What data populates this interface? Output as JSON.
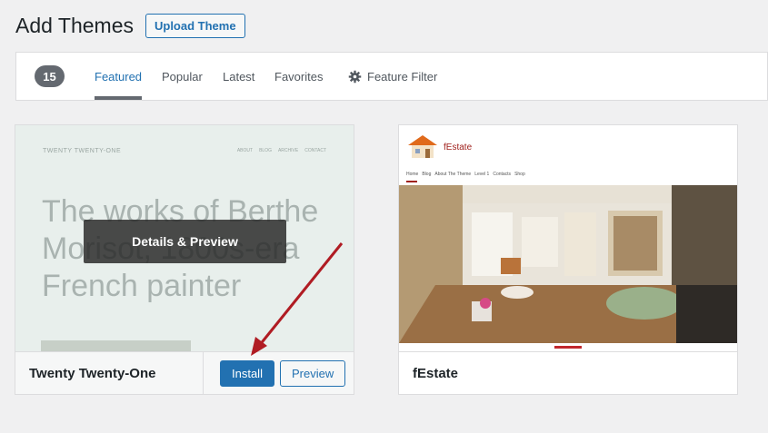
{
  "header": {
    "title": "Add Themes",
    "upload_label": "Upload Theme"
  },
  "filter_bar": {
    "count": "15",
    "tabs": [
      {
        "label": "Featured",
        "active": true
      },
      {
        "label": "Popular"
      },
      {
        "label": "Latest"
      },
      {
        "label": "Favorites"
      }
    ],
    "feature_filter_label": "Feature Filter",
    "feature_filter_icon": "gear-icon"
  },
  "themes": [
    {
      "name": "Twenty Twenty-One",
      "overlay_label": "Details & Preview",
      "install_label": "Install",
      "preview_label": "Preview",
      "screenshot": {
        "site_logo": "TWENTY TWENTY-ONE",
        "nav_items": [
          "ABOUT",
          "BLOG",
          "ARCHIVE",
          "CONTACT"
        ],
        "headline": "The works of Berthe Morisot, 1800s-era French painter"
      }
    },
    {
      "name": "fEstate",
      "screenshot": {
        "brand": "fEstate",
        "menu_items": [
          "Home",
          "Blog",
          "About The Theme",
          "Level 1",
          "Contacts",
          "Shop"
        ]
      }
    }
  ],
  "colors": {
    "accent": "#2271b1",
    "annotation_arrow": "#b01c23",
    "brand_red": "#a0211d"
  }
}
